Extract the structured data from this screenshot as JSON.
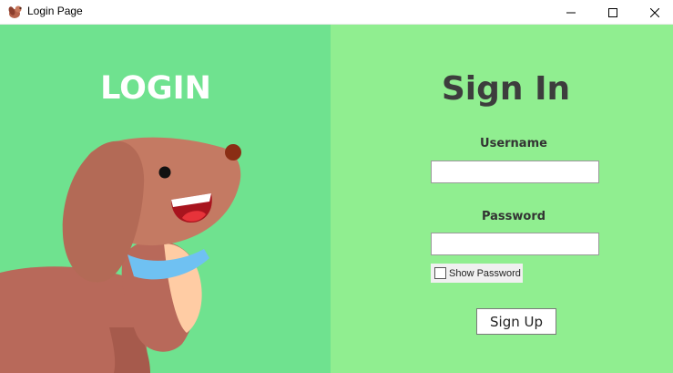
{
  "window": {
    "title": "Login Page",
    "app_icon": "dog-app-icon",
    "controls": {
      "minimize_icon": "minimize-icon",
      "maximize_icon": "maximize-icon",
      "close_icon": "close-icon"
    }
  },
  "left_panel": {
    "heading": "LOGIN",
    "background_color": "#6fe28f",
    "illustration": "cartoon-dog-illustration"
  },
  "right_panel": {
    "heading": "Sign In",
    "background_color": "#90ee90",
    "username": {
      "label": "Username",
      "value": ""
    },
    "password": {
      "label": "Password",
      "value": ""
    },
    "show_password": {
      "label": "Show Password",
      "checked": false
    },
    "submit_button": {
      "label": "Sign Up"
    }
  }
}
